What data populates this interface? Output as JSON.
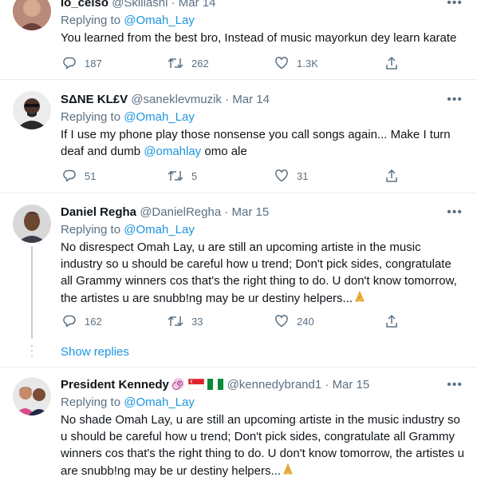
{
  "tweets": [
    {
      "name": "lo_celso",
      "handle": "@Skillashi",
      "date": "Mar 14",
      "replying_prefix": "Replying to",
      "replying_to": "@Omah_Lay",
      "text": "You learned from the best bro, Instead of music mayorkun dey learn karate",
      "replies": "187",
      "retweets": "262",
      "likes": "1.3K"
    },
    {
      "name": "SΔNE KL£V",
      "handle": "@saneklevmuzik",
      "date": "Mar 14",
      "replying_prefix": "Replying to",
      "replying_to": "@Omah_Lay",
      "text_before": "If I use my phone play those nonsense you call songs again... Make I turn deaf and dumb ",
      "text_mention": "@omahlay",
      "text_after": " omo ale",
      "replies": "51",
      "retweets": "5",
      "likes": "31"
    },
    {
      "name": "Daniel Regha",
      "handle": "@DanielRegha",
      "date": "Mar 15",
      "replying_prefix": "Replying to",
      "replying_to": "@Omah_Lay",
      "text": "No disrespect Omah Lay, u are still an upcoming artiste in the music industry so u should be careful how u trend; Don't pick sides, congratulate all Grammy winners cos that's the right thing to do. U don't know tomorrow, the artistes u are snubb!ng may be ur destiny helpers...",
      "replies": "162",
      "retweets": "33",
      "likes": "240"
    },
    {
      "name": "President Kennedy",
      "handle": "@kennedybrand1",
      "date": "Mar 15",
      "replying_prefix": "Replying to",
      "replying_to": "@Omah_Lay",
      "text": "No shade Omah Lay, u are still an upcoming artiste in the music industry so u should be careful how u trend; Don't pick sides, congratulate all Grammy winners cos that's the right thing to do. U don't know tomorrow, the artistes u are snubb!ng may be ur destiny helpers..."
    }
  ],
  "dot": "·",
  "more_label": "•••",
  "show_replies": "Show replies",
  "colors": {
    "accent": "#1b95e0",
    "muted": "#5b7083",
    "divider": "#e6ecf0"
  },
  "icons": [
    "reply-icon",
    "retweet-icon",
    "like-icon",
    "share-icon",
    "more-icon",
    "pray-emoji",
    "spiral-emoji",
    "singapore-flag",
    "nigeria-flag"
  ]
}
